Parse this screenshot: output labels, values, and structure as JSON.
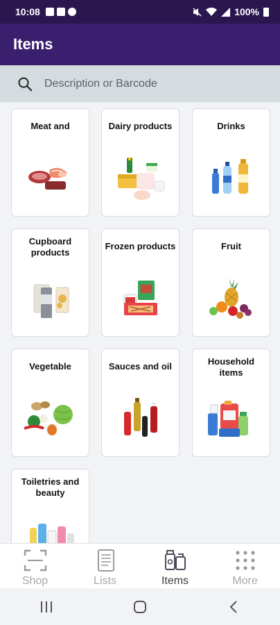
{
  "status_bar": {
    "time": "10:08",
    "battery": "100%"
  },
  "app_bar": {
    "title": "Items"
  },
  "search": {
    "placeholder": "Description or Barcode"
  },
  "categories": [
    {
      "label": "Meat and",
      "icon": "meat-icon"
    },
    {
      "label": "Dairy products",
      "icon": "dairy-icon"
    },
    {
      "label": "Drinks",
      "icon": "drinks-icon"
    },
    {
      "label": "Cupboard products",
      "icon": "cupboard-icon"
    },
    {
      "label": "Frozen products",
      "icon": "frozen-icon"
    },
    {
      "label": "Fruit",
      "icon": "fruit-icon"
    },
    {
      "label": "Vegetable",
      "icon": "vegetable-icon"
    },
    {
      "label": "Sauces and oil",
      "icon": "sauces-icon"
    },
    {
      "label": "Household items",
      "icon": "household-icon"
    },
    {
      "label": "Toiletries and beauty",
      "icon": "toiletries-icon"
    }
  ],
  "bottom_nav": [
    {
      "label": "Shop",
      "icon": "scan-icon",
      "active": false
    },
    {
      "label": "Lists",
      "icon": "list-icon",
      "active": false
    },
    {
      "label": "Items",
      "icon": "items-icon",
      "active": true
    },
    {
      "label": "More",
      "icon": "more-grid-icon",
      "active": false
    }
  ],
  "colors": {
    "status_bar": "#2a1750",
    "app_bar": "#3a1f6e",
    "search_bar": "#d5dce0",
    "background": "#f1f3f6"
  }
}
